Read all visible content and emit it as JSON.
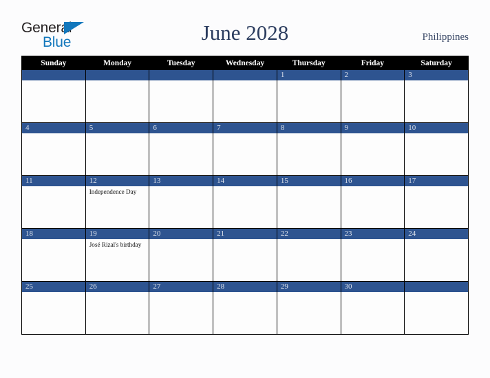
{
  "brand": {
    "name_part1": "General",
    "name_part2": "Blue",
    "accent_color": "#1277bc"
  },
  "header": {
    "title": "June 2028",
    "country": "Philippines",
    "title_color": "#2b3c5e"
  },
  "calendar": {
    "month": "June",
    "year": "2028",
    "header_bg": "#000000",
    "daybar_bg": "#2e5490",
    "cell_bg": "#fdfdfd",
    "weekday_headers": [
      "Sunday",
      "Monday",
      "Tuesday",
      "Wednesday",
      "Thursday",
      "Friday",
      "Saturday"
    ],
    "weeks": [
      [
        {
          "day": "",
          "events": []
        },
        {
          "day": "",
          "events": []
        },
        {
          "day": "",
          "events": []
        },
        {
          "day": "",
          "events": []
        },
        {
          "day": "1",
          "events": []
        },
        {
          "day": "2",
          "events": []
        },
        {
          "day": "3",
          "events": []
        }
      ],
      [
        {
          "day": "4",
          "events": []
        },
        {
          "day": "5",
          "events": []
        },
        {
          "day": "6",
          "events": []
        },
        {
          "day": "7",
          "events": []
        },
        {
          "day": "8",
          "events": []
        },
        {
          "day": "9",
          "events": []
        },
        {
          "day": "10",
          "events": []
        }
      ],
      [
        {
          "day": "11",
          "events": []
        },
        {
          "day": "12",
          "events": [
            "Independence Day"
          ]
        },
        {
          "day": "13",
          "events": []
        },
        {
          "day": "14",
          "events": []
        },
        {
          "day": "15",
          "events": []
        },
        {
          "day": "16",
          "events": []
        },
        {
          "day": "17",
          "events": []
        }
      ],
      [
        {
          "day": "18",
          "events": []
        },
        {
          "day": "19",
          "events": [
            "José Rizal's birthday"
          ]
        },
        {
          "day": "20",
          "events": []
        },
        {
          "day": "21",
          "events": []
        },
        {
          "day": "22",
          "events": []
        },
        {
          "day": "23",
          "events": []
        },
        {
          "day": "24",
          "events": []
        }
      ],
      [
        {
          "day": "25",
          "events": []
        },
        {
          "day": "26",
          "events": []
        },
        {
          "day": "27",
          "events": []
        },
        {
          "day": "28",
          "events": []
        },
        {
          "day": "29",
          "events": []
        },
        {
          "day": "30",
          "events": []
        },
        {
          "day": "",
          "events": []
        }
      ]
    ]
  }
}
